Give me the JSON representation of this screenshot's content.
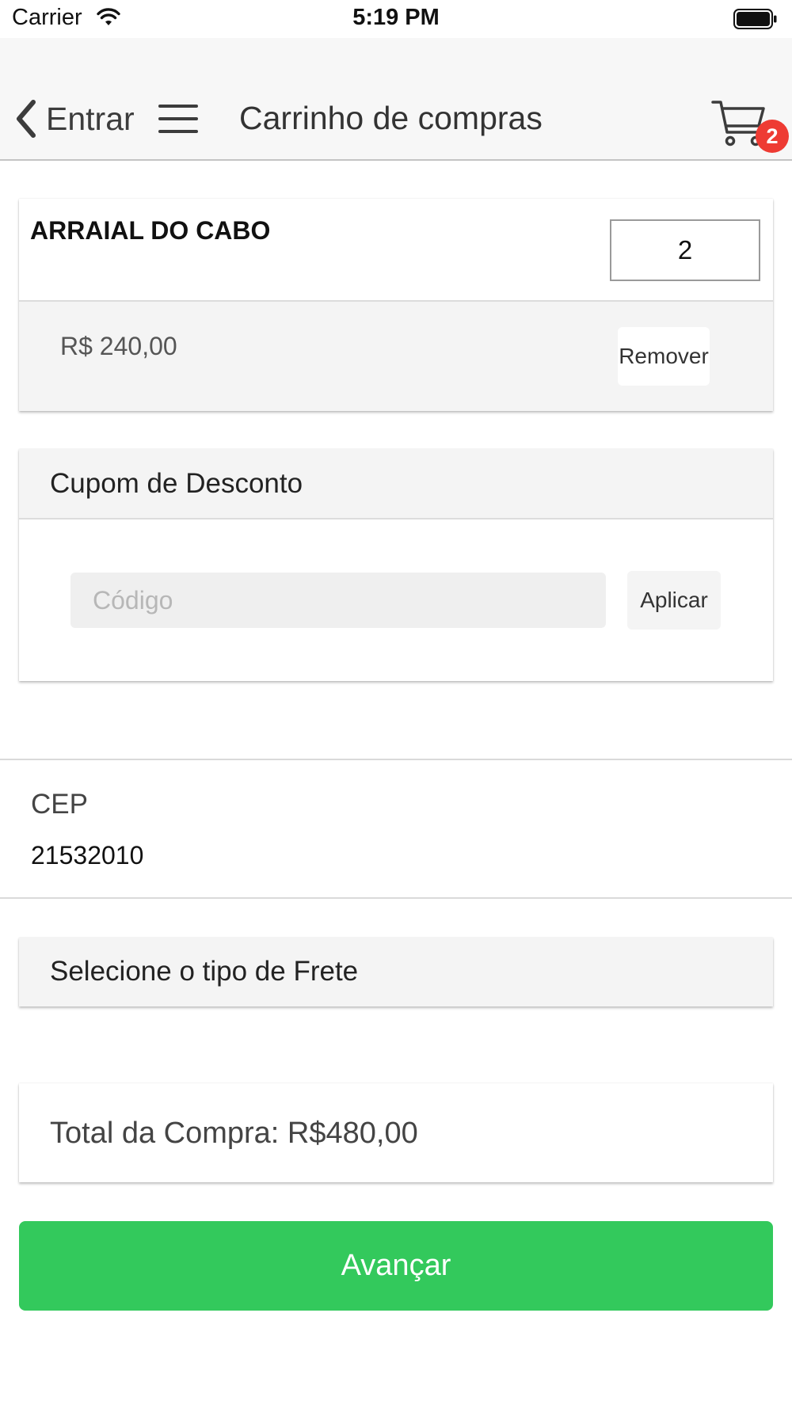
{
  "status_bar": {
    "carrier": "Carrier",
    "time": "5:19 PM"
  },
  "nav": {
    "back_label": "Entrar",
    "title": "Carrinho de compras",
    "cart_badge": "2",
    "icons": [
      "chevron-left-icon",
      "hamburger-menu-icon",
      "shopping-cart-icon"
    ]
  },
  "cart_item": {
    "name": "ARRAIAL DO CABO",
    "quantity": "2",
    "price": "R$ 240,00",
    "remove_label": "Remover"
  },
  "coupon": {
    "title": "Cupom de Desconto",
    "placeholder": "Código",
    "value": "",
    "apply_label": "Aplicar"
  },
  "cep": {
    "label": "CEP",
    "value": "21532010"
  },
  "shipping": {
    "title": "Selecione o tipo de Frete"
  },
  "total": {
    "text": "Total da Compra: R$480,00"
  },
  "advance_button": {
    "label": "Avançar"
  },
  "colors": {
    "accent_green": "#33c95c",
    "badge_red": "#ee3b33",
    "navbar_bg": "#f7f7f7",
    "section_header_bg": "#f4f4f4"
  }
}
